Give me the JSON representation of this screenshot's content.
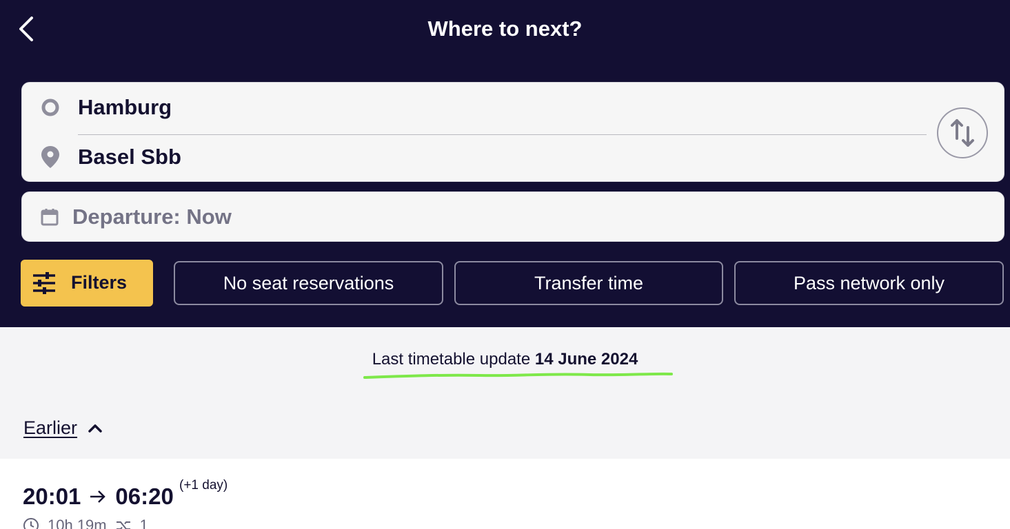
{
  "header": {
    "title": "Where to next?",
    "back_icon": "chevron-left-icon"
  },
  "route": {
    "from": "Hamburg",
    "to": "Basel Sbb",
    "from_icon": "circle-origin-icon",
    "to_icon": "map-pin-icon",
    "swap_icon": "swap-vertical-icon"
  },
  "date": {
    "label": "Departure: Now",
    "icon": "calendar-icon"
  },
  "filters": {
    "button_label": "Filters",
    "icon": "sliders-icon",
    "chips": [
      "No seat reservations",
      "Transfer time",
      "Pass network only"
    ]
  },
  "timetable": {
    "prefix": "Last timetable update",
    "date": "14 June 2024"
  },
  "earlier": {
    "label": "Earlier",
    "icon": "chevron-up-icon"
  },
  "trip": {
    "depart": "20:01",
    "arrive": "06:20",
    "extra": "(+1 day)",
    "duration": "10h 19m",
    "transfers": "1"
  },
  "colors": {
    "header_bg": "#130f33",
    "accent": "#f4c34e",
    "highlight": "#7ee84a"
  }
}
